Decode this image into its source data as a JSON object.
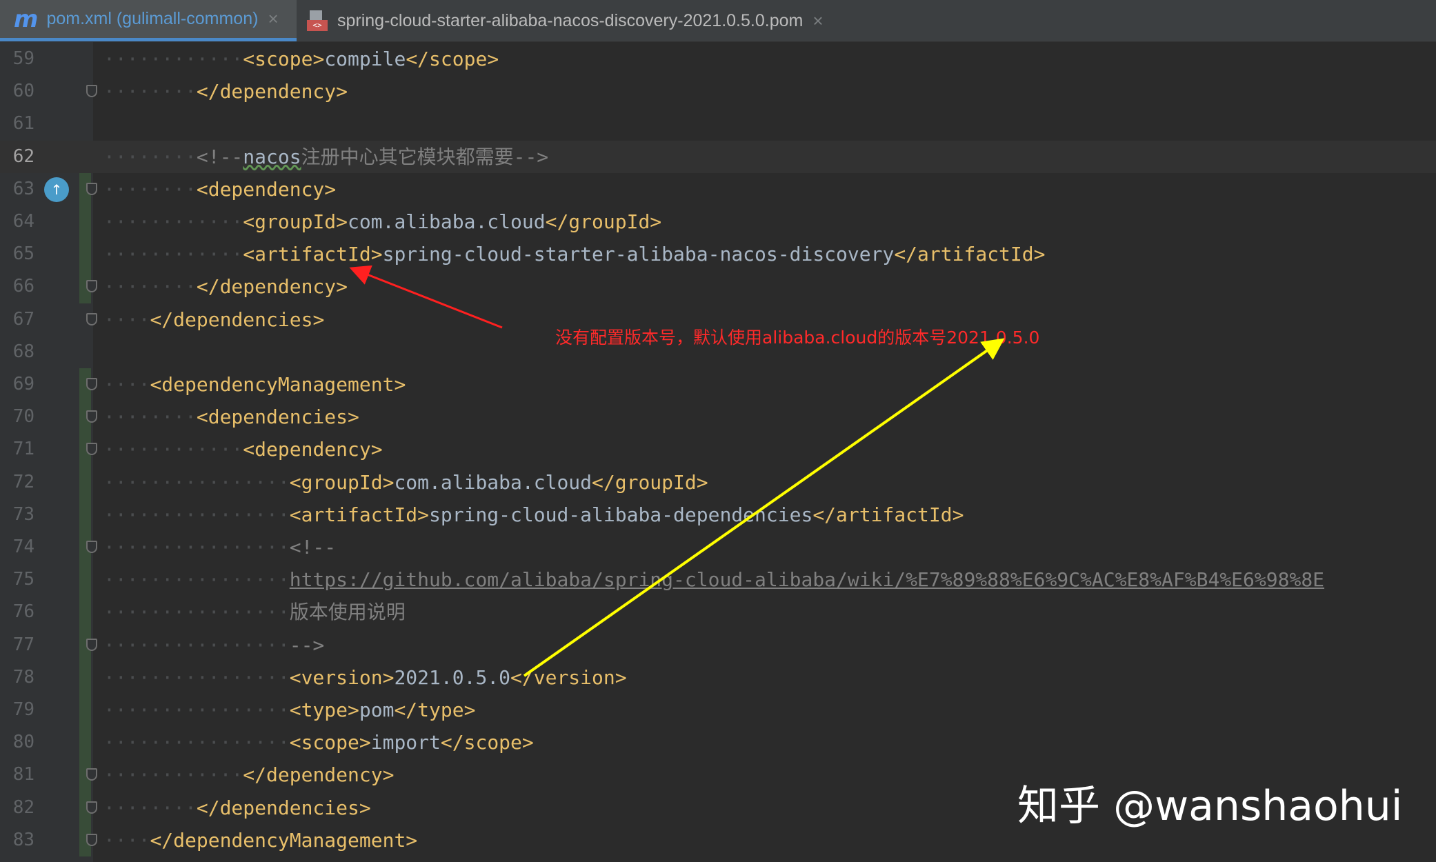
{
  "tabs": [
    {
      "icon": "maven-m-icon",
      "label": "pom.xml (gulimall-common)",
      "active": true
    },
    {
      "icon": "pom-file-icon",
      "label": "spring-cloud-starter-alibaba-nacos-discovery-2021.0.5.0.pom",
      "active": false
    }
  ],
  "tab_close_glyph": "×",
  "lines": [
    {
      "n": "59",
      "parts": [
        [
          "tag",
          "<scope>"
        ],
        [
          "txt",
          "compile"
        ],
        [
          "tag",
          "</scope>"
        ]
      ]
    },
    {
      "n": "60",
      "parts": [
        [
          "tag",
          "</dependency>"
        ]
      ]
    },
    {
      "n": "61",
      "parts": []
    },
    {
      "n": "62",
      "parts": [
        [
          "cmt",
          "<!--"
        ],
        [
          "squig",
          "nacos"
        ],
        [
          "cmt",
          "注册中心其它模块都需要-->"
        ]
      ]
    },
    {
      "n": "63",
      "parts": [
        [
          "tag",
          "<dependency>"
        ]
      ]
    },
    {
      "n": "64",
      "parts": [
        [
          "tag",
          "<groupId>"
        ],
        [
          "txt",
          "com.alibaba.cloud"
        ],
        [
          "tag",
          "</groupId>"
        ]
      ]
    },
    {
      "n": "65",
      "parts": [
        [
          "tag",
          "<artifactId>"
        ],
        [
          "txt",
          "spring-cloud-starter-alibaba-nacos-discovery"
        ],
        [
          "tag",
          "</artifactId>"
        ]
      ]
    },
    {
      "n": "66",
      "parts": [
        [
          "tag",
          "</dependency>"
        ]
      ]
    },
    {
      "n": "67",
      "parts": [
        [
          "tag",
          "</dependencies>"
        ]
      ]
    },
    {
      "n": "68",
      "parts": []
    },
    {
      "n": "69",
      "parts": [
        [
          "tag",
          "<dependencyManagement>"
        ]
      ]
    },
    {
      "n": "70",
      "parts": [
        [
          "tag",
          "<dependencies>"
        ]
      ]
    },
    {
      "n": "71",
      "parts": [
        [
          "tag",
          "<dependency>"
        ]
      ]
    },
    {
      "n": "72",
      "parts": [
        [
          "tag",
          "<groupId>"
        ],
        [
          "txt",
          "com.alibaba.cloud"
        ],
        [
          "tag",
          "</groupId>"
        ]
      ]
    },
    {
      "n": "73",
      "parts": [
        [
          "tag",
          "<artifactId>"
        ],
        [
          "txt",
          "spring-cloud-alibaba-dependencies"
        ],
        [
          "tag",
          "</artifactId>"
        ]
      ]
    },
    {
      "n": "74",
      "parts": [
        [
          "cmt",
          "<!--"
        ]
      ]
    },
    {
      "n": "75",
      "parts": [
        [
          "link",
          "https://github.com/alibaba/spring-cloud-alibaba/wiki/%E7%89%88%E6%9C%AC%E8%AF%B4%E6%98%8E"
        ]
      ]
    },
    {
      "n": "76",
      "parts": [
        [
          "cmt",
          "版本使用说明"
        ]
      ]
    },
    {
      "n": "77",
      "parts": [
        [
          "cmt",
          "-->"
        ]
      ]
    },
    {
      "n": "78",
      "parts": [
        [
          "tag",
          "<version>"
        ],
        [
          "txt",
          "2021.0.5.0"
        ],
        [
          "tag",
          "</version>"
        ]
      ]
    },
    {
      "n": "79",
      "parts": [
        [
          "tag",
          "<type>"
        ],
        [
          "txt",
          "pom"
        ],
        [
          "tag",
          "</type>"
        ]
      ]
    },
    {
      "n": "80",
      "parts": [
        [
          "tag",
          "<scope>"
        ],
        [
          "txt",
          "import"
        ],
        [
          "tag",
          "</scope>"
        ]
      ]
    },
    {
      "n": "81",
      "parts": [
        [
          "tag",
          "</dependency>"
        ]
      ]
    },
    {
      "n": "82",
      "parts": [
        [
          "tag",
          "</dependencies>"
        ]
      ]
    },
    {
      "n": "83",
      "parts": [
        [
          "tag",
          "</dependencyManagement>"
        ]
      ]
    }
  ],
  "annotation": "没有配置版本号，默认使用alibaba.cloud的版本号2021.0.5.0",
  "watermark": "知乎 @wanshaohui",
  "colors": {
    "annotation_arrow": "#ff2020",
    "highlight_arrow": "#ffff00",
    "tag": "#e8bf6a",
    "comment": "#808080"
  }
}
